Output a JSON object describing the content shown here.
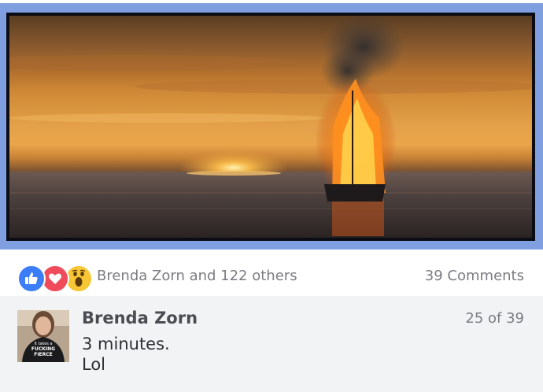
{
  "post": {
    "image_icon": "burning-ship-at-sunset-image"
  },
  "reactions": {
    "icons": [
      "like-icon",
      "love-icon",
      "wow-icon"
    ],
    "summary": "Brenda Zorn and 122 others",
    "comments_count": "39 Comments"
  },
  "comment": {
    "author": "Brenda Zorn",
    "position": "25 of 39",
    "lines": [
      "3 minutes.",
      "Lol"
    ],
    "avatar_shirt_text": [
      "It takes a",
      "FUCKING",
      "FIERCE"
    ]
  },
  "colors": {
    "frame": "#7f9fe0",
    "like": "#3b7ef7",
    "love": "#ef4b5b",
    "wow": "#f7c634",
    "meta_text": "#7a7c82",
    "comment_bg": "#f2f3f5"
  }
}
